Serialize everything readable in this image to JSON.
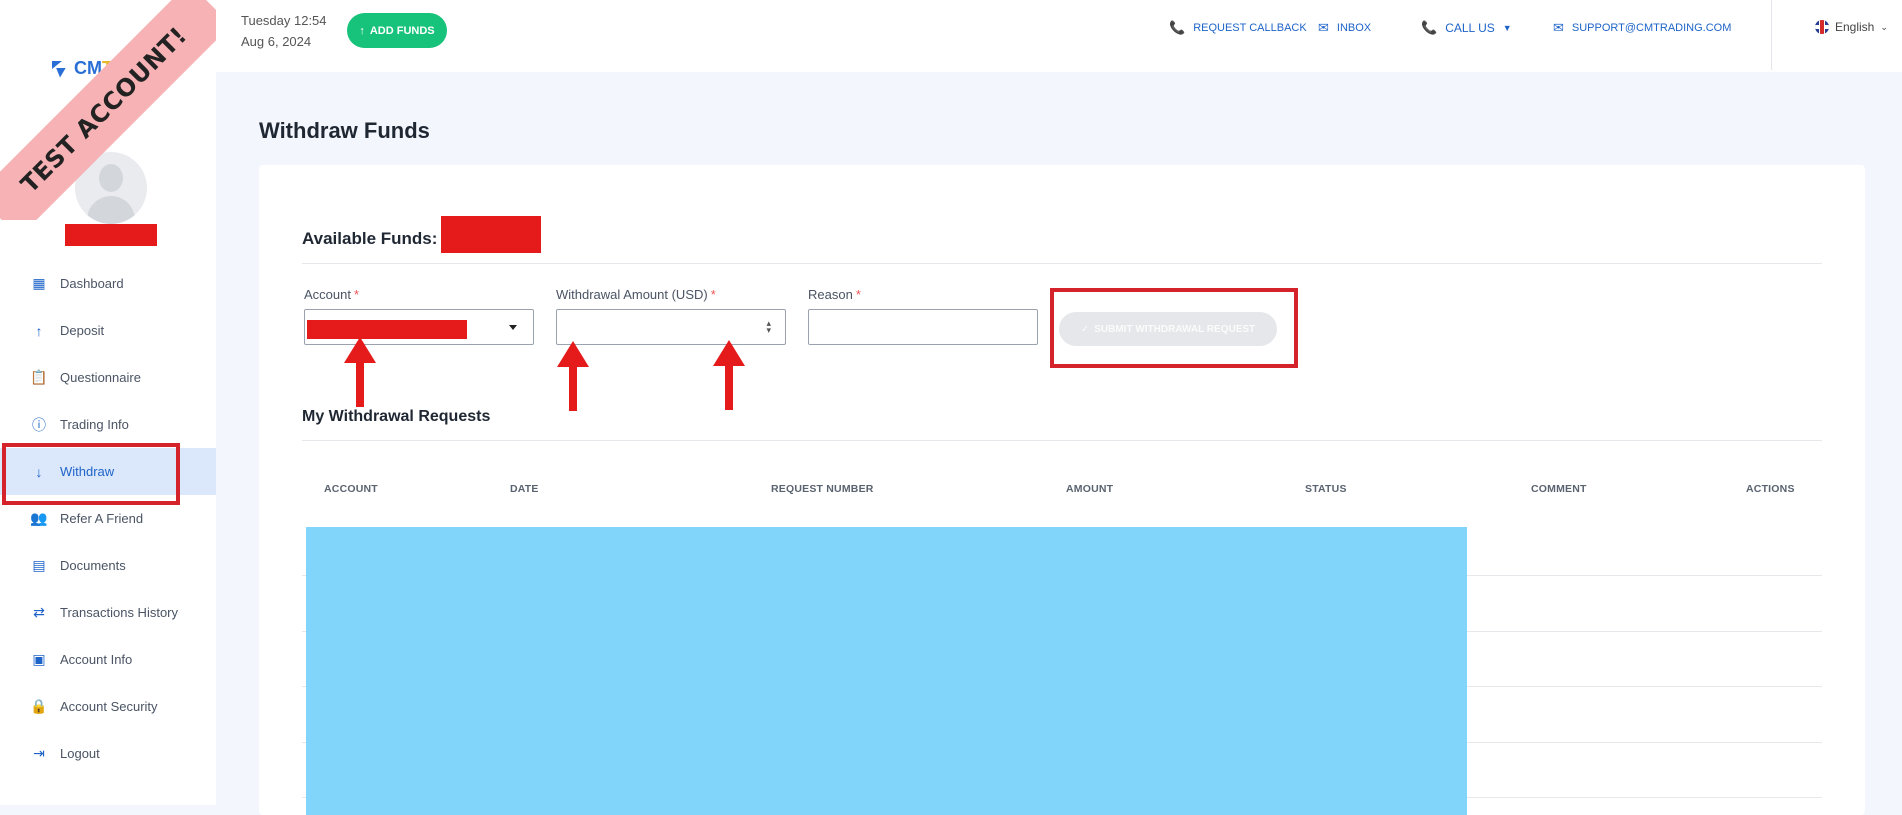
{
  "sidebar": {
    "ribbon_text": "TEST ACCOUNT!",
    "logo_text_a": "CM",
    "logo_text_b": "TRADING",
    "items": [
      {
        "label": "Dashboard",
        "icon": "dashboard-icon",
        "glyph": "▦"
      },
      {
        "label": "Deposit",
        "icon": "arrow-up-icon",
        "glyph": "↑"
      },
      {
        "label": "Questionnaire",
        "icon": "clipboard-icon",
        "glyph": "📋"
      },
      {
        "label": "Trading Info",
        "icon": "info-circle-icon",
        "glyph": "ⓘ"
      },
      {
        "label": "Withdraw",
        "icon": "arrow-down-icon",
        "glyph": "↓"
      },
      {
        "label": "Refer A Friend",
        "icon": "add-user-icon",
        "glyph": "👥"
      },
      {
        "label": "Documents",
        "icon": "document-icon",
        "glyph": "▤"
      },
      {
        "label": "Transactions History",
        "icon": "swap-icon",
        "glyph": "⇄"
      },
      {
        "label": "Account Info",
        "icon": "contact-card-icon",
        "glyph": "▣"
      },
      {
        "label": "Account Security",
        "icon": "lock-icon",
        "glyph": "🔒"
      },
      {
        "label": "Logout",
        "icon": "logout-icon",
        "glyph": "⇥"
      }
    ],
    "active_item": "Withdraw"
  },
  "topbar": {
    "day_time": "Tuesday 12:54",
    "date": "Aug 6, 2024",
    "add_funds_label": "ADD FUNDS",
    "request_callback": "REQUEST CALLBACK",
    "inbox": "INBOX",
    "call_us": "CALL US",
    "support_email": "SUPPORT@CMTRADING.COM",
    "language": "English"
  },
  "main": {
    "page_title": "Withdraw Funds",
    "available_funds_label": "Available Funds:",
    "form": {
      "account_label": "Account",
      "amount_label": "Withdrawal Amount (USD)",
      "reason_label": "Reason",
      "required_mark": "*",
      "amount_value": "",
      "reason_value": "",
      "submit_label": "SUBMIT WITHDRAWAL REQUEST"
    },
    "requests_title": "My Withdrawal Requests",
    "table_headers": [
      "ACCOUNT",
      "DATE",
      "REQUEST NUMBER",
      "AMOUNT",
      "STATUS",
      "COMMENT",
      "ACTIONS"
    ]
  },
  "colors": {
    "accent": "#1e64c8",
    "add_funds": "#17c27b",
    "annotation_red": "#d4232b",
    "redaction_red": "#e51b1b",
    "redaction_blue": "#81d4fa",
    "ribbon": "#f6b2b4"
  }
}
